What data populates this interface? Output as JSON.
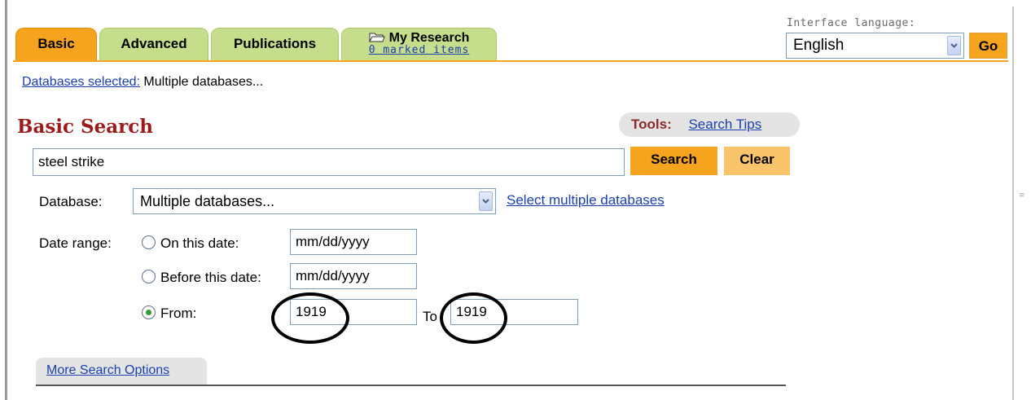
{
  "tabs": {
    "basic": "Basic",
    "advanced": "Advanced",
    "publications": "Publications",
    "my_research": "My Research",
    "marked_items": "0 marked items"
  },
  "language": {
    "label": "Interface language:",
    "selected": "English",
    "go_label": "Go"
  },
  "databases": {
    "link_text": "Databases selected:",
    "value": " Multiple databases..."
  },
  "page_title": "Basic Search",
  "tools": {
    "label": "Tools:",
    "search_tips": "Search Tips"
  },
  "search": {
    "query": "steel strike",
    "search_button": "Search",
    "clear_button": "Clear"
  },
  "database_field": {
    "label": "Database:",
    "selected": "Multiple databases...",
    "select_multiple_link": "Select multiple databases"
  },
  "date_range": {
    "label": "Date range:",
    "options": [
      "On this date:",
      "Before this date:",
      "From:"
    ],
    "selected_option": "From:",
    "on_date_value": "mm/dd/yyyy",
    "before_date_value": "mm/dd/yyyy",
    "from_value": "1919",
    "to_label": "To",
    "to_value": "1919"
  },
  "more_options": "More Search Options",
  "icons": [
    "folder-icon",
    "chevron-down-icon",
    "radio-icon"
  ],
  "colors": {
    "active_tab": "#f6a31e",
    "inactive_tab": "#c6dd8b",
    "title": "#9b1b1b",
    "link": "#1a3fb0"
  }
}
